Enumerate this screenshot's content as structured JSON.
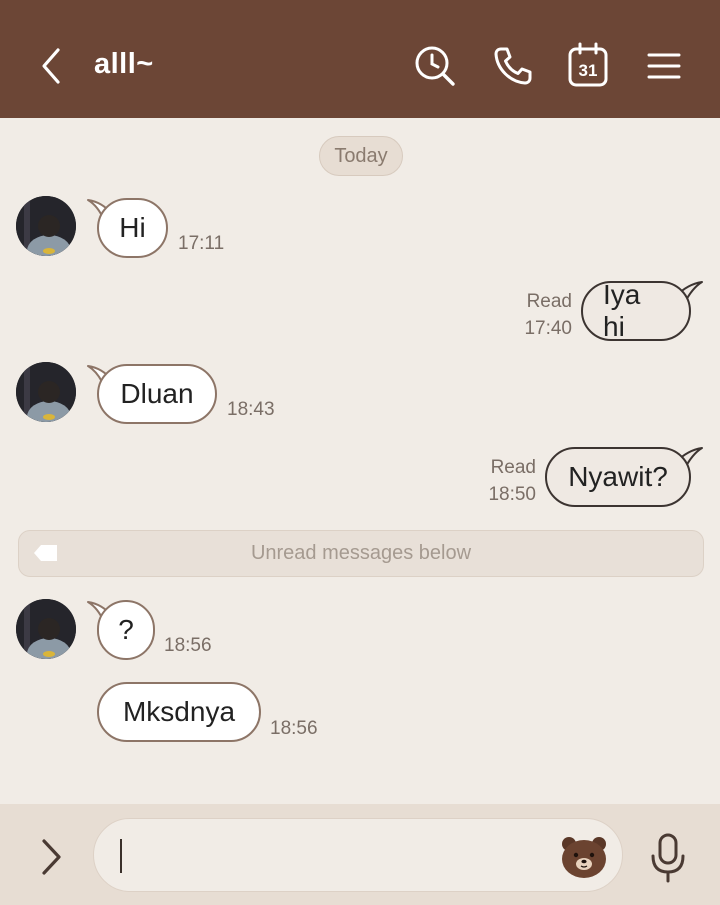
{
  "header": {
    "title": "alll~",
    "icons": [
      "back-icon",
      "search-icon",
      "phone-icon",
      "calendar-icon",
      "menu-icon"
    ],
    "calendar_day": "31",
    "background_color": "#6c4636"
  },
  "chat": {
    "date_label": "Today",
    "unread_label": "Unread messages below",
    "messages": [
      {
        "direction": "in",
        "text": "Hi",
        "time": "17:11"
      },
      {
        "direction": "out",
        "text": "Iya hi",
        "status": "Read",
        "time": "17:40"
      },
      {
        "direction": "in",
        "text": "Dluan",
        "time": "18:43"
      },
      {
        "direction": "out",
        "text": "Nyawit?",
        "status": "Read",
        "time": "18:50"
      },
      {
        "direction": "in",
        "text": "?",
        "time": "18:56"
      },
      {
        "direction": "in",
        "text": "Mksdnya",
        "time": "18:56"
      }
    ]
  },
  "input": {
    "value": "",
    "icons": [
      "chevron-right-icon",
      "bear-sticker-icon",
      "microphone-icon"
    ]
  }
}
